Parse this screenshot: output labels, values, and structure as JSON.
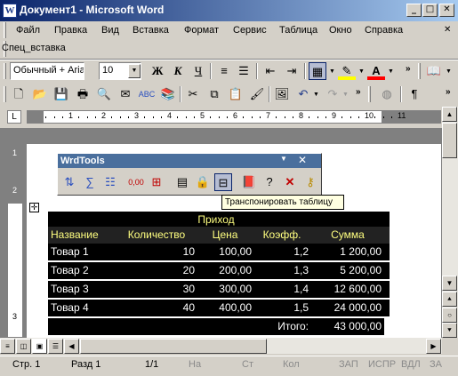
{
  "window": {
    "title": "Документ1 - Microsoft Word",
    "app_icon": "W",
    "min": "_",
    "max": "□",
    "close": "✕"
  },
  "menu": [
    "Файл",
    "Правка",
    "Вид",
    "Вставка",
    "Формат",
    "Сервис",
    "Таблица",
    "Окно",
    "Справка"
  ],
  "menu_close": "✕",
  "extra_menu": "Спец_вставка",
  "format_bar": {
    "style": "Обычный + Aria",
    "size": "10",
    "bold": "Ж",
    "italic": "К",
    "underline": "Ч"
  },
  "wrdtools": {
    "title": "WrdTools",
    "tooltip": "Транспонировать таблицу"
  },
  "ruler_marks": [
    "1",
    "2",
    "3",
    "4",
    "5",
    "6",
    "7",
    "8",
    "9",
    "10",
    "11"
  ],
  "table": {
    "group_header": "Приход",
    "headers": [
      "Название",
      "Количество",
      "Цена",
      "Коэфф.",
      "Сумма"
    ],
    "rows": [
      [
        "Товар 1",
        "10",
        "100,00",
        "1,2",
        "1 200,00"
      ],
      [
        "Товар 2",
        "20",
        "200,00",
        "1,3",
        "5 200,00"
      ],
      [
        "Товар 3",
        "30",
        "300,00",
        "1,4",
        "12 600,00"
      ],
      [
        "Товар 4",
        "40",
        "400,00",
        "1,5",
        "24 000,00"
      ]
    ],
    "total_label": "Итого:",
    "total_value": "43 000,00"
  },
  "status": {
    "page": "Стр. 1",
    "section": "Разд 1",
    "pages": "1/1",
    "at": "На",
    "line": "Ст",
    "col": "Кол",
    "rec": "ЗАП",
    "trk": "ИСПР",
    "ext": "ВДЛ",
    "ovr": "ЗА"
  },
  "colors": {
    "title_start": "#0a246a",
    "header_text": "#ffff80",
    "table_bg": "#000000",
    "cell_text": "#ffffff"
  }
}
